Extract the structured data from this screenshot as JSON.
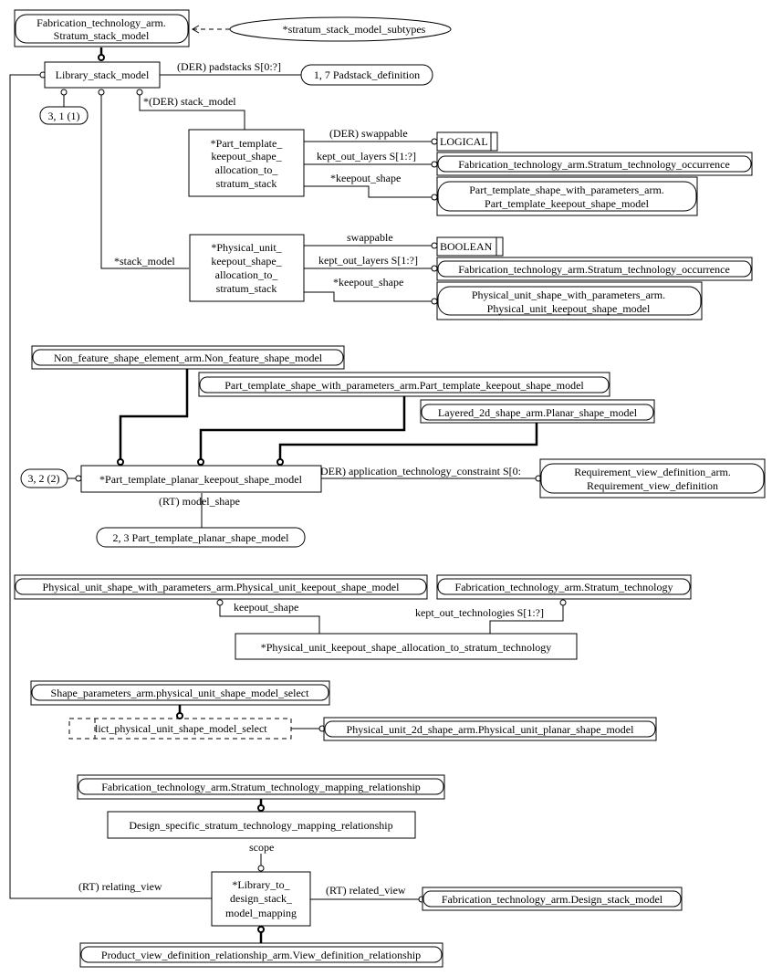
{
  "diagram": {
    "type": "EXPRESS-G entity-level diagram",
    "entities": {
      "stratum_stack_model": [
        "Fabrication_technology_arm.",
        "Stratum_stack_model"
      ],
      "stratum_stack_subtypes": "*stratum_stack_model_subtypes",
      "library_stack_model": "Library_stack_model",
      "padstack_ref": "1, 7 Padstack_definition",
      "ref_3_1": "3, 1 (1)",
      "part_template_alloc": [
        "*Part_template_",
        "keepout_shape_",
        "allocation_to_",
        "stratum_stack"
      ],
      "logical": "LOGICAL",
      "stratum_occ_1": "Fabrication_technology_arm.Stratum_technology_occurrence",
      "pt_keepout_model_2line": [
        "Part_template_shape_with_parameters_arm.",
        "Part_template_keepout_shape_model"
      ],
      "physical_unit_alloc": [
        "*Physical_unit_",
        "keepout_shape_",
        "allocation_to_",
        "stratum_stack"
      ],
      "boolean": "BOOLEAN",
      "stratum_occ_2": "Fabrication_technology_arm.Stratum_technology_occurrence",
      "pu_keepout_model_2line": [
        "Physical_unit_shape_with_parameters_arm.",
        "Physical_unit_keepout_shape_model"
      ],
      "non_feature_shape": "Non_feature_shape_element_arm.Non_feature_shape_model",
      "pt_keepout_model": "Part_template_shape_with_parameters_arm.Part_template_keepout_shape_model",
      "planar_shape_model": "Layered_2d_shape_arm.Planar_shape_model",
      "ref_3_2": "3, 2 (2)",
      "pt_planar_keepout": "*Part_template_planar_keepout_shape_model",
      "requirement_view": [
        "Requirement_view_definition_arm.",
        "Requirement_view_definition"
      ],
      "ref_2_3": "2, 3 Part_template_planar_shape_model",
      "pu_keepout_model": "Physical_unit_shape_with_parameters_arm.Physical_unit_keepout_shape_model",
      "stratum_technology": "Fabrication_technology_arm.Stratum_technology",
      "pu_alloc_technology": "*Physical_unit_keepout_shape_allocation_to_stratum_technology",
      "shape_param_select": "Shape_parameters_arm.physical_unit_shape_model_select",
      "lict_select": "lict_physical_unit_shape_model_select",
      "pu_planar_shape": "Physical_unit_2d_shape_arm.Physical_unit_planar_shape_model",
      "stratum_tech_mapping": "Fabrication_technology_arm.Stratum_technology_mapping_relationship",
      "design_specific_mapping": "Design_specific_stratum_technology_mapping_relationship",
      "library_to_design": [
        "*Library_to_",
        "design_stack_",
        "model_mapping"
      ],
      "design_stack_model": "Fabrication_technology_arm.Design_stack_model",
      "view_def_relationship": "Product_view_definition_relationship_arm.View_definition_relationship"
    },
    "relations": {
      "padstacks": "(DER) padstacks S[0:?]",
      "der_stack_model": "*(DER) stack_model",
      "der_swappable": "(DER) swappable",
      "kept_out_layers_1": "kept_out_layers S[1:?]",
      "keepout_shape_1": "*keepout_shape",
      "stack_model": "*stack_model",
      "swappable": "swappable",
      "kept_out_layers_2": "kept_out_layers S[1:?]",
      "keepout_shape_2": "*keepout_shape",
      "app_tech_constraint": "DER) application_technology_constraint S[0:",
      "model_shape": "(RT) model_shape",
      "keepout_shape_3": "keepout_shape",
      "kept_out_technologies": "kept_out_technologies S[1:?]",
      "scope": "scope",
      "relating_view": "(RT) relating_view",
      "related_view": "(RT) related_view"
    }
  }
}
